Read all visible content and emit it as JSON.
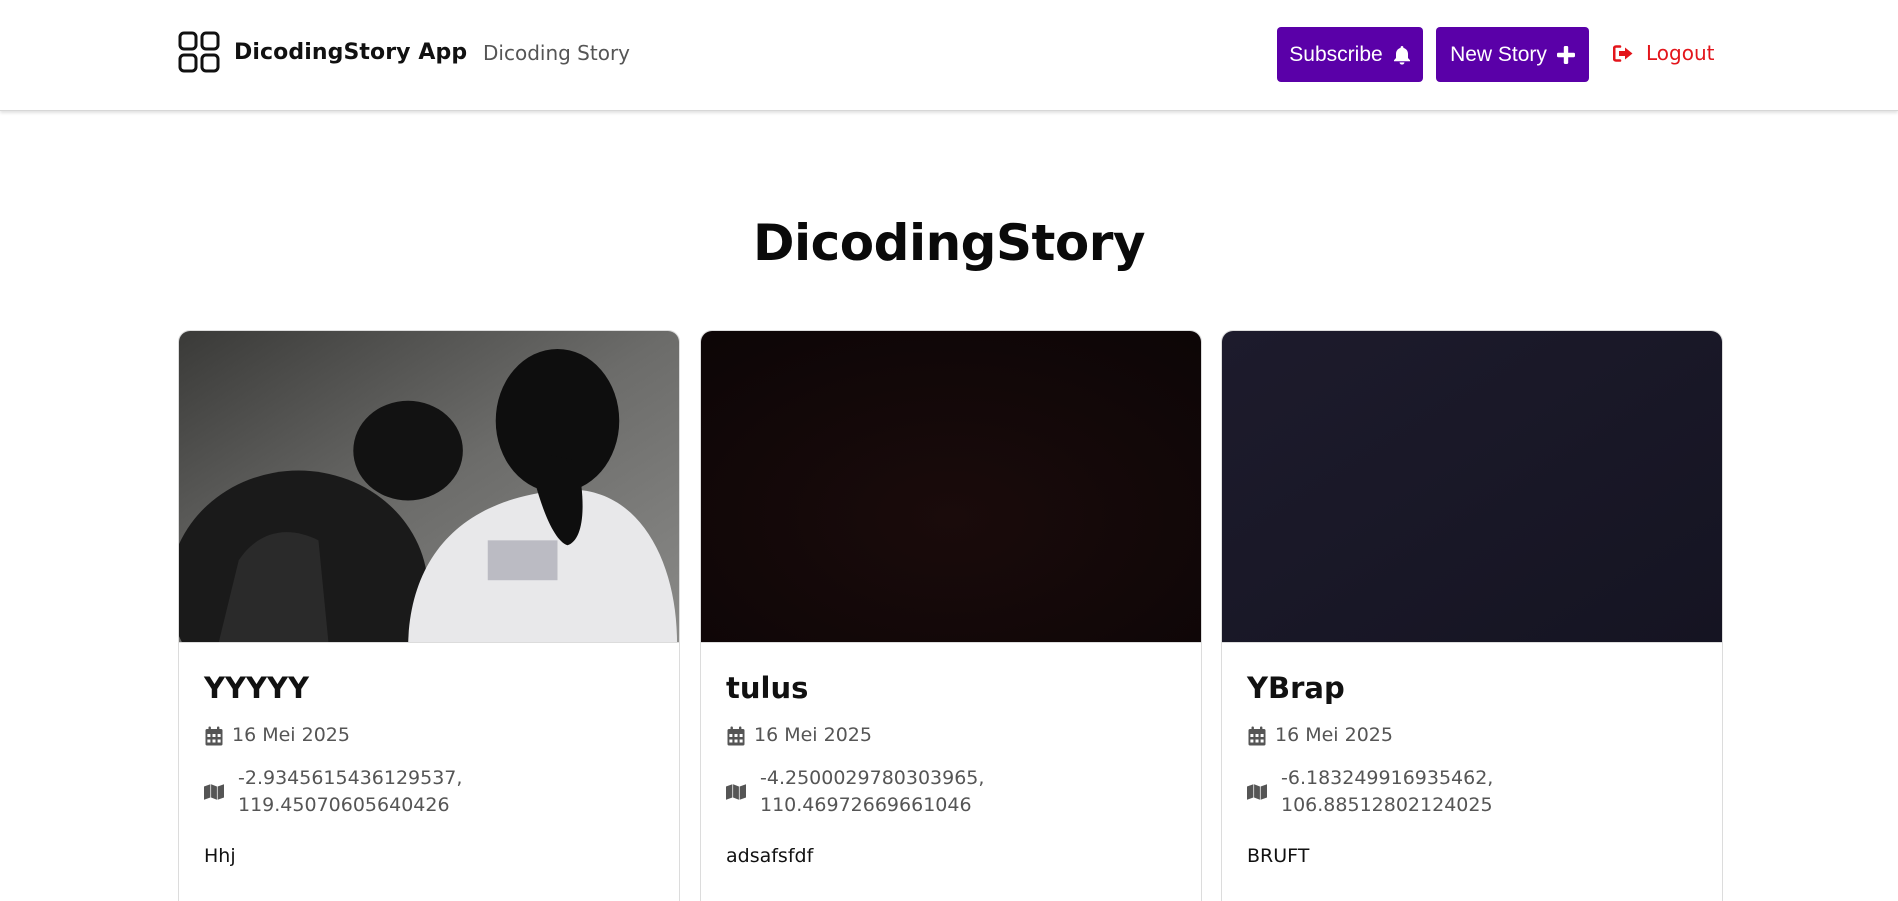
{
  "header": {
    "brand_name": "DicodingStory App",
    "nav_link": "Dicoding Story",
    "subscribe_label": "Subscribe",
    "new_story_label": "New Story",
    "logout_label": "Logout",
    "brand_icon": "grid-icon",
    "subscribe_icon": "bell-icon",
    "new_story_icon": "plus-icon",
    "logout_icon": "sign-out-icon"
  },
  "page": {
    "title": "DicodingStory"
  },
  "stories": [
    {
      "name": "YYYYY",
      "date": "16 Mei 2025",
      "location_line1": "-2.9345615436129537,",
      "location_line2": "119.45070605640426",
      "description": "Hhj"
    },
    {
      "name": "tulus",
      "date": "16 Mei 2025",
      "location_line1": "-4.2500029780303965,",
      "location_line2": "110.46972669661046",
      "description": "adsafsfdf"
    },
    {
      "name": "YBrap",
      "date": "16 Mei 2025",
      "location_line1": "-6.183249916935462,",
      "location_line2": "106.88512802124025",
      "description": "BRUFT"
    }
  ],
  "colors": {
    "primary_button": "#5a00a8",
    "logout": "#e3151b",
    "meta_text": "#555555"
  }
}
